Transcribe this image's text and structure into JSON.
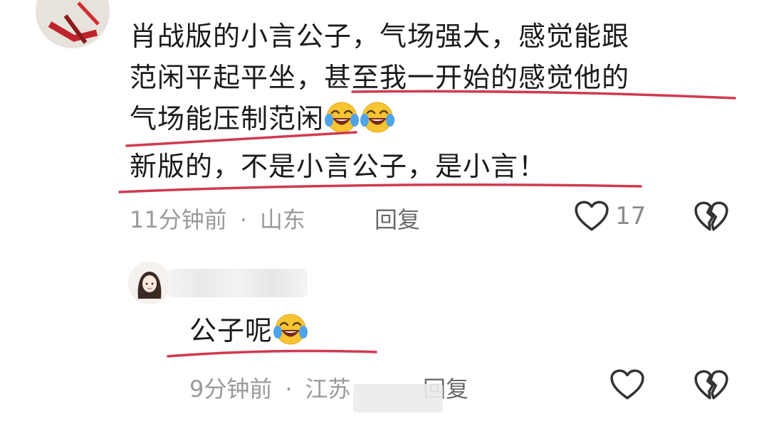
{
  "comment": {
    "lines": [
      "肖战版的小言公子，气场强大，感觉能跟",
      "范闲平起平坐，甚至我一开始的感觉他的",
      "气场能压制范闲",
      "新版的，不是小言公子，是小言！"
    ],
    "time": "11分钟前",
    "location": "山东",
    "reply_label": "回复",
    "like_count": "17"
  },
  "reply": {
    "text": "公子呢",
    "time": "9分钟前",
    "location": "江苏",
    "reply_label": "回复"
  },
  "colors": {
    "underline": "#d03a50",
    "meta": "#9a9a9a"
  },
  "icons": [
    "heart-icon",
    "broken-heart-icon",
    "laughing-crying-emoji"
  ]
}
